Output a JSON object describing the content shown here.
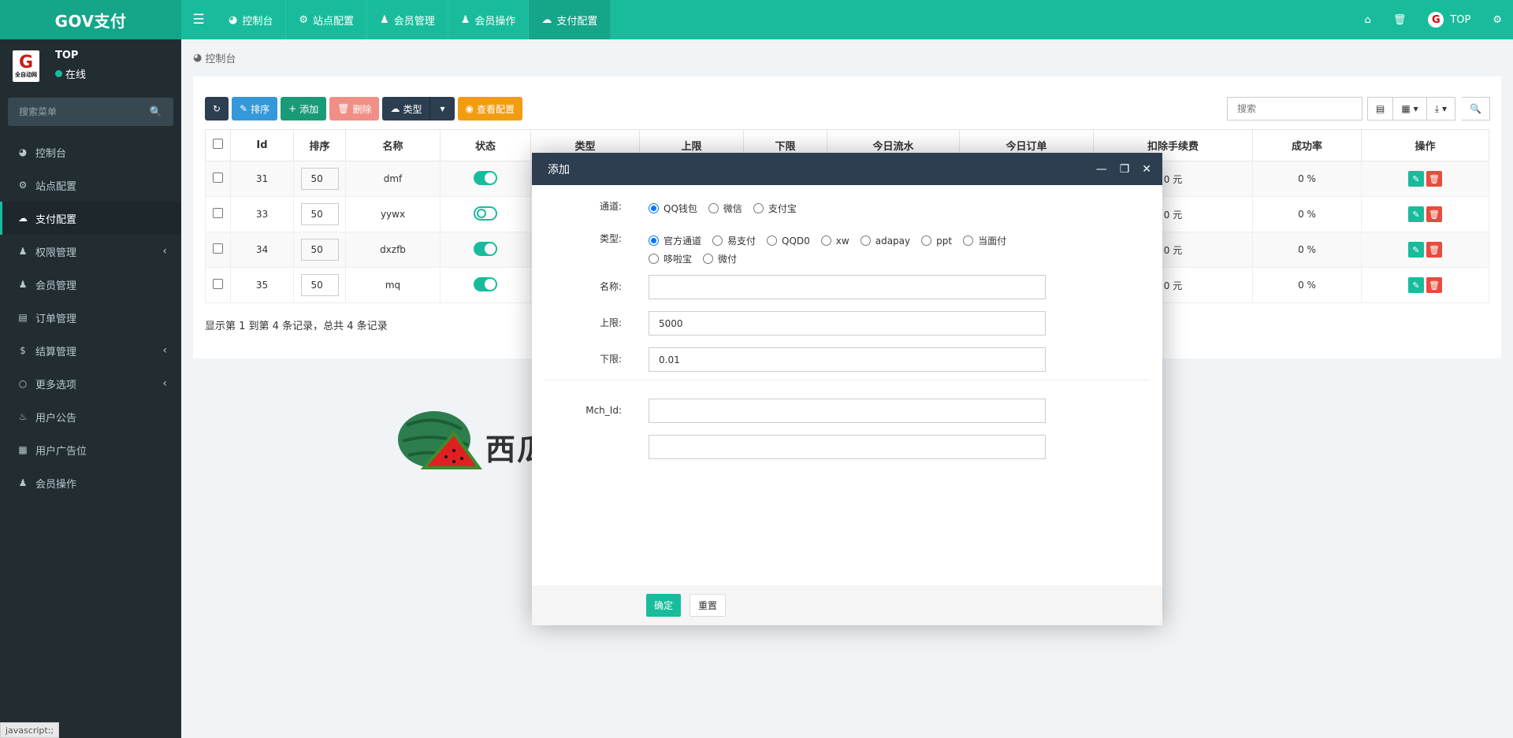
{
  "app": {
    "brand": "GOV支付"
  },
  "topnav": {
    "items": [
      {
        "icon": "dashboard-icon",
        "label": "控制台"
      },
      {
        "icon": "gear-icon",
        "label": "站点配置"
      },
      {
        "icon": "user-icon",
        "label": "会员管理"
      },
      {
        "icon": "user-icon",
        "label": "会员操作"
      },
      {
        "icon": "cloud-icon",
        "label": "支付配置"
      }
    ],
    "active_index": 4,
    "right": {
      "user": "TOP",
      "avatar_letter": "G"
    }
  },
  "sidebar": {
    "user": {
      "name": "TOP",
      "status": "在线",
      "avatar_letter": "G",
      "avatar_caption": "全自动网"
    },
    "search_placeholder": "搜索菜单",
    "items": [
      {
        "icon": "dashboard-icon",
        "label": "控制台",
        "expandable": false
      },
      {
        "icon": "gear-icon",
        "label": "站点配置",
        "expandable": false
      },
      {
        "icon": "cloud-icon",
        "label": "支付配置",
        "expandable": false,
        "active": true
      },
      {
        "icon": "users-icon",
        "label": "权限管理",
        "expandable": true
      },
      {
        "icon": "user-icon",
        "label": "会员管理",
        "expandable": false
      },
      {
        "icon": "briefcase-icon",
        "label": "订单管理",
        "expandable": false
      },
      {
        "icon": "dollar-icon",
        "label": "结算管理",
        "expandable": true
      },
      {
        "icon": "circle-icon",
        "label": "更多选项",
        "expandable": true
      },
      {
        "icon": "bell-icon",
        "label": "用户公告",
        "expandable": false
      },
      {
        "icon": "newspaper-icon",
        "label": "用户广告位",
        "expandable": false
      },
      {
        "icon": "user-icon",
        "label": "会员操作",
        "expandable": false
      }
    ]
  },
  "breadcrumb": {
    "label": "控制台"
  },
  "toolbar": {
    "refresh": "",
    "sort": "排序",
    "add": "添加",
    "delete": "删除",
    "type": "类型",
    "view_config": "查看配置",
    "search_placeholder": "搜索"
  },
  "table": {
    "headers": [
      "Id",
      "排序",
      "名称",
      "状态",
      "类型",
      "上限",
      "下限",
      "今日流水",
      "今日订单",
      "扣除手续费",
      "成功率",
      "操作"
    ],
    "rows": [
      {
        "id": "31",
        "sort": "50",
        "name": "dmf",
        "enabled": true,
        "fee": "0 元",
        "rate": "0 %"
      },
      {
        "id": "33",
        "sort": "50",
        "name": "yywx",
        "enabled": false,
        "fee": "0 元",
        "rate": "0 %"
      },
      {
        "id": "34",
        "sort": "50",
        "name": "dxzfb",
        "enabled": true,
        "fee": "0 元",
        "rate": "0 %"
      },
      {
        "id": "35",
        "sort": "50",
        "name": "mq",
        "enabled": true,
        "fee": "0 元",
        "rate": "0 %"
      }
    ],
    "pageinfo": "显示第 1 到第 4 条记录，总共 4 条记录"
  },
  "watermark": {
    "text": "西瓜源码"
  },
  "modal": {
    "title": "添加",
    "channel": {
      "label": "通道:",
      "options": [
        "QQ钱包",
        "微信",
        "支付宝"
      ],
      "selected": 0
    },
    "type": {
      "label": "类型:",
      "options": [
        "官方通道",
        "易支付",
        "QQD0",
        "xw",
        "adapay",
        "ppt",
        "当面付",
        "哆啦宝",
        "微付"
      ],
      "selected": 0
    },
    "name": {
      "label": "名称:",
      "value": ""
    },
    "upper": {
      "label": "上限:",
      "value": "5000"
    },
    "lower": {
      "label": "下限:",
      "value": "0.01"
    },
    "mch_id": {
      "label": "Mch_Id:",
      "value": ""
    },
    "key": {
      "label": "",
      "value": ""
    },
    "ok": "确定",
    "reset": "重置"
  },
  "statusbar": {
    "text": "javascript:;"
  },
  "colors": {
    "primary": "#18bc9c",
    "sidebar": "#222d32",
    "dark": "#2c3e50",
    "danger": "#e74c3c",
    "warning": "#f39c12",
    "info": "#3498db"
  }
}
